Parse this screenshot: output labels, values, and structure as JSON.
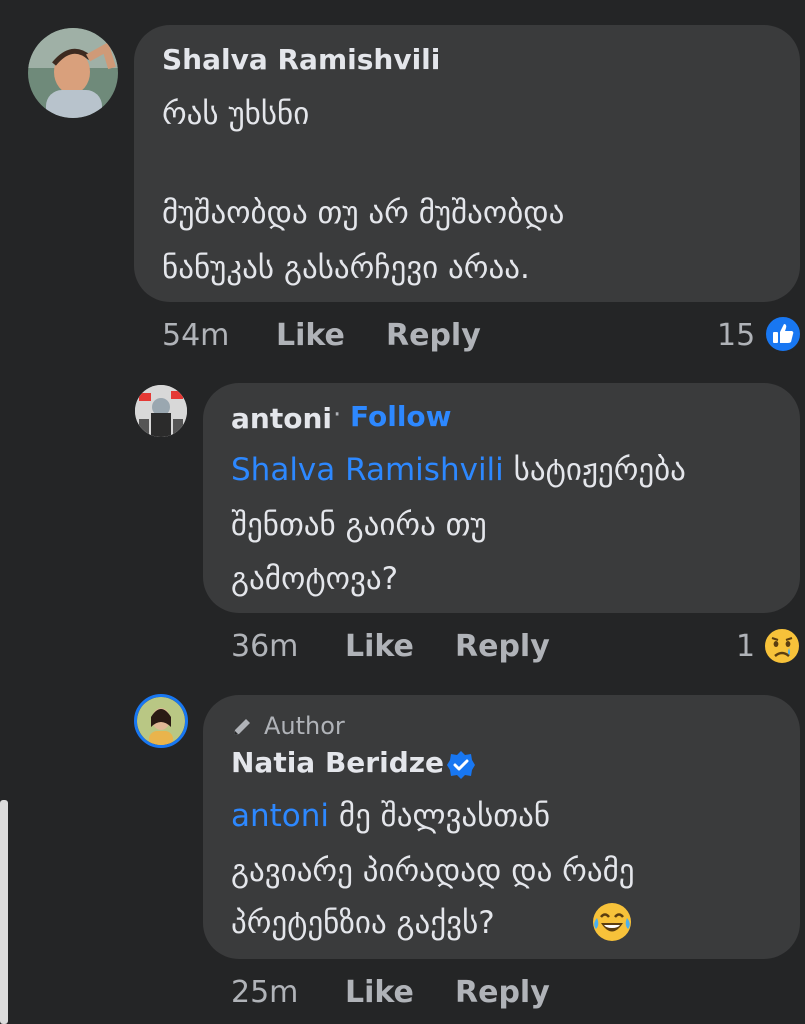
{
  "comments": [
    {
      "author": "Shalva Ramishvili",
      "lines": [
        "რას უხსნი",
        "",
        " მუშაობდა თუ არ მუშაობდა",
        "ნანუკას გასარჩევი არაა."
      ],
      "time": "54m",
      "like_label": "Like",
      "reply_label": "Reply",
      "reaction_count": "15",
      "reaction_icon": "like-icon"
    },
    {
      "author": "antoni",
      "separator": "·",
      "follow_label": "Follow",
      "mention": "Shalva Ramishvili",
      "lines": [
        " სატიჟერება",
        "შენთან გაირა თუ",
        "გამოტოვა?"
      ],
      "time": "36m",
      "like_label": "Like",
      "reply_label": "Reply",
      "reaction_count": "1",
      "reaction_icon": "sad-emoji-icon"
    },
    {
      "badge": "Author",
      "author": "Natia Beridze",
      "verified_icon": "verified-badge-icon",
      "mention": "antoni",
      "lines": [
        " მე შალვასთან",
        "გავიარე პირადად და რამე",
        "პრეტენზია გაქვს? "
      ],
      "emoji": "laughing-emoji-icon",
      "time": "25m",
      "like_label": "Like",
      "reply_label": "Reply"
    }
  ],
  "colors": {
    "background": "#242526",
    "bubble": "#3a3b3c",
    "accent": "#2d88ff",
    "secondary_text": "#b0b3b8"
  }
}
